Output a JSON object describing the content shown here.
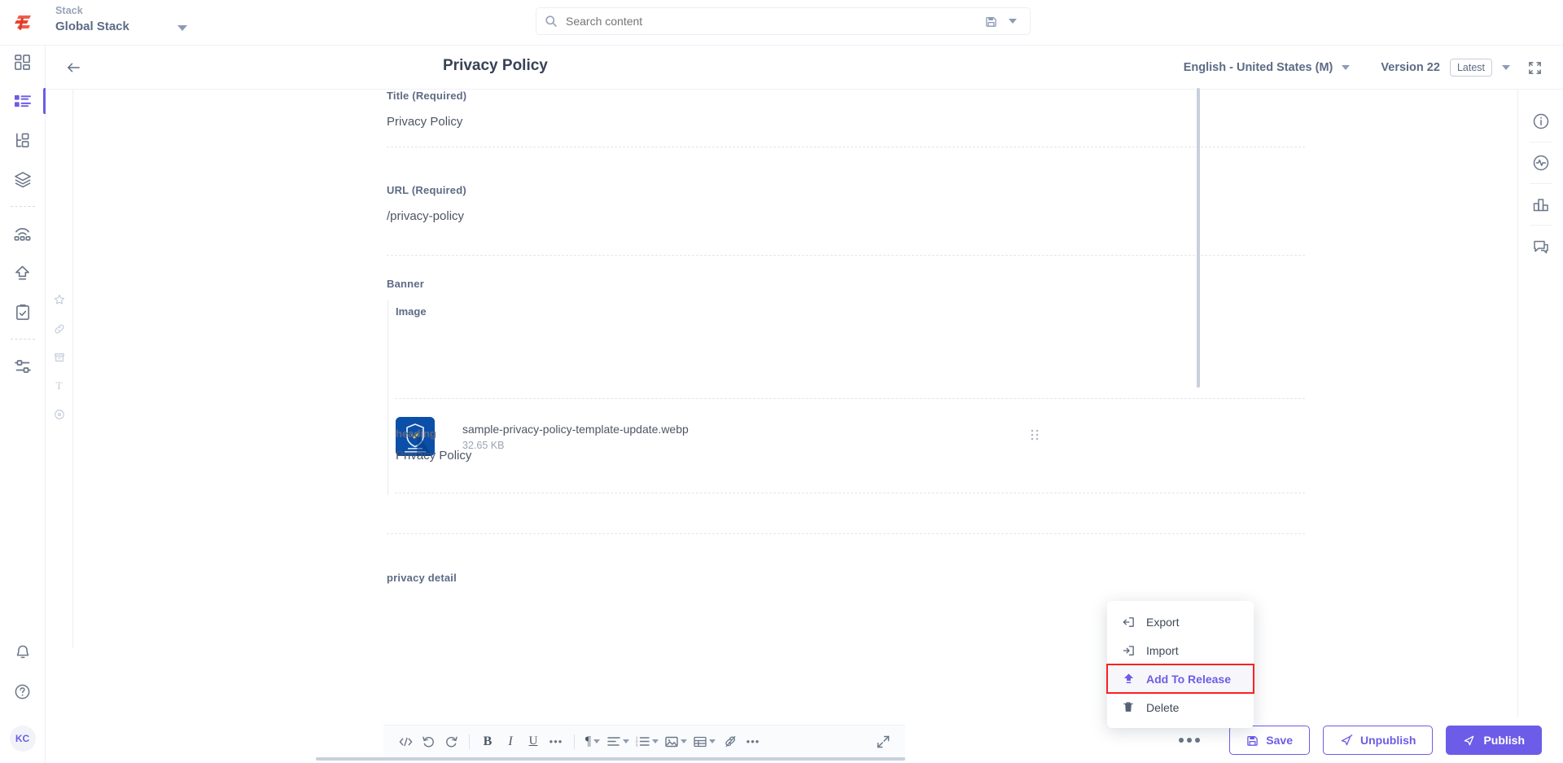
{
  "topbar": {
    "logo_icon": "contentstack-logo-icon",
    "stack": {
      "label": "Stack",
      "value": "Global Stack",
      "caret_icon": "chevron-down-icon"
    },
    "search": {
      "placeholder": "Search content",
      "value": "",
      "search_icon": "search-icon",
      "saved_icon": "save-disk-icon",
      "caret_icon": "chevron-down-icon"
    }
  },
  "left_rail": {
    "items": [
      {
        "name": "sidebar-item-dashboard",
        "icon": "dashboard-grid-icon",
        "active": false
      },
      {
        "name": "sidebar-item-entries",
        "icon": "content-list-icon",
        "active": true
      },
      {
        "name": "sidebar-item-content-types",
        "icon": "sitemap-icon",
        "active": false
      },
      {
        "name": "sidebar-item-assets",
        "icon": "layers-icon",
        "active": false
      },
      {
        "name": "sidebar-item-environments",
        "icon": "broadcast-icon",
        "active": false
      },
      {
        "name": "sidebar-item-releases",
        "icon": "upload-arrow-icon",
        "active": false
      },
      {
        "name": "sidebar-item-workflow",
        "icon": "clipboard-check-icon",
        "active": false
      },
      {
        "name": "sidebar-item-settings",
        "icon": "sliders-icon",
        "active": false
      }
    ],
    "bottom": [
      {
        "name": "notifications-button",
        "icon": "bell-icon"
      },
      {
        "name": "help-button",
        "icon": "question-circle-icon"
      }
    ],
    "avatar_initials": "KC"
  },
  "sub_rail": {
    "items": [
      {
        "name": "favorite-button",
        "icon": "star-icon"
      },
      {
        "name": "link-button",
        "icon": "link-icon"
      },
      {
        "name": "archive-button",
        "icon": "box-icon"
      },
      {
        "name": "text-button",
        "icon": "text-t-icon"
      },
      {
        "name": "tag-button",
        "icon": "circle-icon"
      }
    ]
  },
  "entry_header": {
    "back_icon": "arrow-left-icon",
    "title": "Privacy Policy",
    "locale": "English - United States (M)",
    "locale_caret_icon": "chevron-down-icon",
    "version_label": "Version 22",
    "latest_badge": "Latest",
    "version_caret_icon": "chevron-down-icon",
    "collapse_icon": "collapse-icon"
  },
  "form": {
    "fields": [
      {
        "label": "Title (Required)",
        "value": "Privacy Policy"
      },
      {
        "label": "URL (Required)",
        "value": "/privacy-policy"
      }
    ],
    "banner": {
      "label": "Banner",
      "image_label": "Image",
      "asset": {
        "filename": "sample-privacy-policy-template-update.webp",
        "filesize": "32.65 KB",
        "thumb_icon": "shield-check-icon",
        "thumb_caption_1": "Sample",
        "thumb_caption_2": "Privacy Policy Template",
        "drag_icon": "drag-handle-icon"
      },
      "heading_label": "heading",
      "heading_value": "Privacy Policy"
    },
    "privacy_detail_label": "privacy detail"
  },
  "right_rail": {
    "items": [
      {
        "name": "entry-details-button",
        "icon": "info-circle-icon"
      },
      {
        "name": "activity-button",
        "icon": "pulse-circle-icon"
      },
      {
        "name": "versions-button",
        "icon": "bar-chart-icon"
      },
      {
        "name": "comments-button",
        "icon": "comment-icon"
      }
    ]
  },
  "rte_toolbar": {
    "buttons": [
      {
        "name": "code-view-button",
        "icon": "code-icon",
        "glyph": "</>"
      },
      {
        "name": "undo-button",
        "icon": "undo-icon",
        "glyph": "↺"
      },
      {
        "name": "redo-button",
        "icon": "redo-icon",
        "glyph": "↻"
      },
      {
        "name": "bold-button",
        "icon": "bold-icon",
        "glyph": "B"
      },
      {
        "name": "italic-button",
        "icon": "italic-icon",
        "glyph": "I"
      },
      {
        "name": "underline-button",
        "icon": "underline-icon",
        "glyph": "U"
      },
      {
        "name": "more-text-format-button",
        "icon": "ellipsis-icon",
        "glyph": "•••"
      },
      {
        "name": "paragraph-style-button",
        "icon": "paragraph-icon",
        "glyph": "¶"
      },
      {
        "name": "align-button",
        "icon": "align-left-icon",
        "glyph": "≡"
      },
      {
        "name": "list-button",
        "icon": "ordered-list-icon",
        "glyph": "≔"
      },
      {
        "name": "insert-image-button",
        "icon": "image-icon",
        "glyph": "▣"
      },
      {
        "name": "insert-table-button",
        "icon": "table-icon",
        "glyph": "▦"
      },
      {
        "name": "insert-link-button",
        "icon": "link-slash-icon",
        "glyph": "⊘"
      },
      {
        "name": "more-options-button",
        "icon": "ellipsis-icon",
        "glyph": "•••"
      },
      {
        "name": "fullscreen-button",
        "icon": "expand-arrows-icon",
        "glyph": "⤢"
      }
    ]
  },
  "action_bar": {
    "more_label": "more-options",
    "buttons": [
      {
        "name": "save-button",
        "label": "Save",
        "icon": "save-disk-icon",
        "style": "outline"
      },
      {
        "name": "unpublish-button",
        "label": "Unpublish",
        "icon": "unpublish-icon",
        "style": "outline"
      },
      {
        "name": "publish-button",
        "label": "Publish",
        "icon": "publish-icon",
        "style": "primary"
      }
    ]
  },
  "context_menu": {
    "items": [
      {
        "label": "Export",
        "icon": "export-icon",
        "highlighted": false
      },
      {
        "label": "Import",
        "icon": "import-icon",
        "highlighted": false
      },
      {
        "label": "Add To Release",
        "icon": "add-to-release-icon",
        "highlighted": true
      },
      {
        "label": "Delete",
        "icon": "trash-icon",
        "highlighted": false
      }
    ]
  },
  "colors": {
    "accent": "#6c5ce7",
    "highlight_outline": "#fd2020",
    "text": "#475161",
    "muted": "#97a3b6"
  }
}
